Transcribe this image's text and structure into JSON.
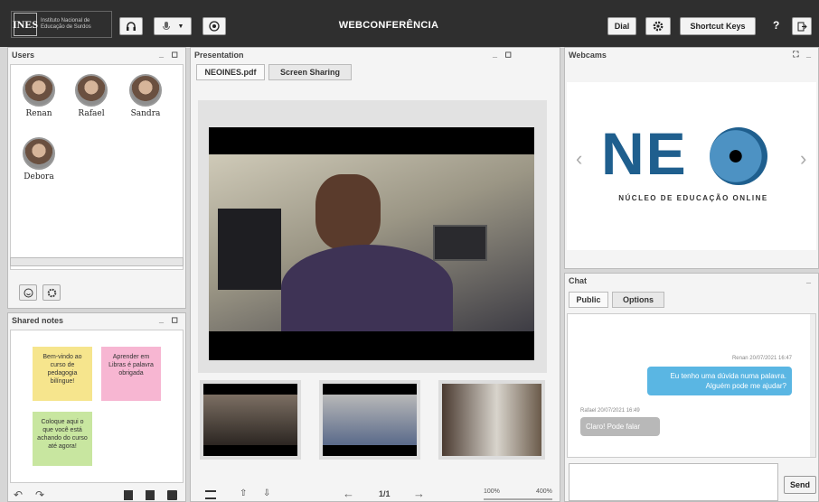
{
  "header": {
    "logo_text": "INES",
    "logo_subtitle": "Instituto Nacional de Educação de Surdos",
    "title": "WEBCONFERÊNCIA",
    "dial_label": "Dial",
    "shortcut_label": "Shortcut Keys",
    "help_label": "?"
  },
  "users_panel": {
    "title": "Users",
    "users": [
      {
        "name": "Renan"
      },
      {
        "name": "Rafael"
      },
      {
        "name": "Sandra"
      },
      {
        "name": "Debora"
      }
    ]
  },
  "notes_panel": {
    "title": "Shared notes",
    "notes": [
      {
        "text": "Bem-vindo ao curso de pedagogia bilíngue!",
        "color": "#f6e58d"
      },
      {
        "text": "Aprender em Libras é palavra obrigada",
        "color": "#f7b6d2"
      },
      {
        "text": "Coloque aqui o que você está achando do curso até agora!",
        "color": "#c8e6a0"
      }
    ]
  },
  "presentation": {
    "title": "Presentation",
    "tabs": [
      "NEOINES.pdf",
      "Screen Sharing"
    ],
    "page_indicator": "1/1",
    "zoom_min": "100%",
    "zoom_max": "400%"
  },
  "webcams": {
    "title": "Webcams",
    "logo_word": "NE",
    "logo_caption": "NÚCLEO DE EDUCAÇÃO ONLINE"
  },
  "chat": {
    "title": "Chat",
    "tabs": [
      "Public",
      "Options"
    ],
    "messages": [
      {
        "meta": "Renan 20/07/2021 16:47",
        "text": "Eu tenho uma dúvida numa palavra. Alguém pode me ajudar?",
        "side": "right"
      },
      {
        "meta": "Rafael 20/07/2021 16:49",
        "text": "Claro! Pode falar",
        "side": "left"
      }
    ],
    "send_label": "Send"
  }
}
